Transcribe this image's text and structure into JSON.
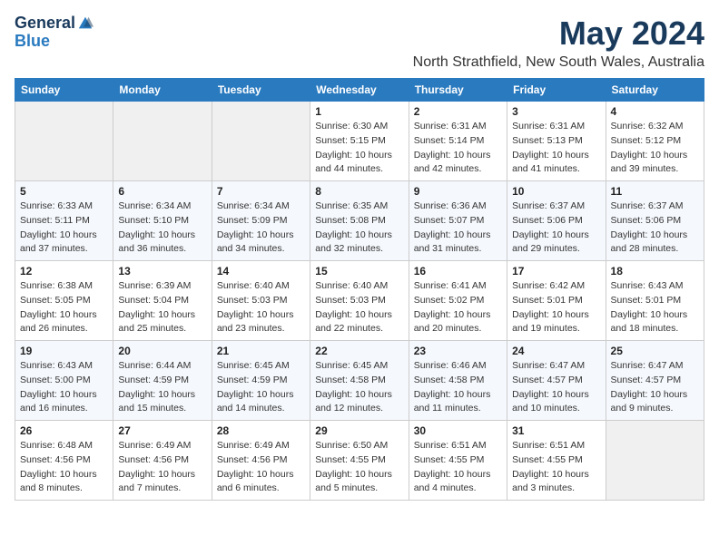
{
  "logo": {
    "general": "General",
    "blue": "Blue"
  },
  "title": "May 2024",
  "subtitle": "North Strathfield, New South Wales, Australia",
  "headers": [
    "Sunday",
    "Monday",
    "Tuesday",
    "Wednesday",
    "Thursday",
    "Friday",
    "Saturday"
  ],
  "weeks": [
    [
      {
        "day": "",
        "info": []
      },
      {
        "day": "",
        "info": []
      },
      {
        "day": "",
        "info": []
      },
      {
        "day": "1",
        "info": [
          "Sunrise: 6:30 AM",
          "Sunset: 5:15 PM",
          "Daylight: 10 hours",
          "and 44 minutes."
        ]
      },
      {
        "day": "2",
        "info": [
          "Sunrise: 6:31 AM",
          "Sunset: 5:14 PM",
          "Daylight: 10 hours",
          "and 42 minutes."
        ]
      },
      {
        "day": "3",
        "info": [
          "Sunrise: 6:31 AM",
          "Sunset: 5:13 PM",
          "Daylight: 10 hours",
          "and 41 minutes."
        ]
      },
      {
        "day": "4",
        "info": [
          "Sunrise: 6:32 AM",
          "Sunset: 5:12 PM",
          "Daylight: 10 hours",
          "and 39 minutes."
        ]
      }
    ],
    [
      {
        "day": "5",
        "info": [
          "Sunrise: 6:33 AM",
          "Sunset: 5:11 PM",
          "Daylight: 10 hours",
          "and 37 minutes."
        ]
      },
      {
        "day": "6",
        "info": [
          "Sunrise: 6:34 AM",
          "Sunset: 5:10 PM",
          "Daylight: 10 hours",
          "and 36 minutes."
        ]
      },
      {
        "day": "7",
        "info": [
          "Sunrise: 6:34 AM",
          "Sunset: 5:09 PM",
          "Daylight: 10 hours",
          "and 34 minutes."
        ]
      },
      {
        "day": "8",
        "info": [
          "Sunrise: 6:35 AM",
          "Sunset: 5:08 PM",
          "Daylight: 10 hours",
          "and 32 minutes."
        ]
      },
      {
        "day": "9",
        "info": [
          "Sunrise: 6:36 AM",
          "Sunset: 5:07 PM",
          "Daylight: 10 hours",
          "and 31 minutes."
        ]
      },
      {
        "day": "10",
        "info": [
          "Sunrise: 6:37 AM",
          "Sunset: 5:06 PM",
          "Daylight: 10 hours",
          "and 29 minutes."
        ]
      },
      {
        "day": "11",
        "info": [
          "Sunrise: 6:37 AM",
          "Sunset: 5:06 PM",
          "Daylight: 10 hours",
          "and 28 minutes."
        ]
      }
    ],
    [
      {
        "day": "12",
        "info": [
          "Sunrise: 6:38 AM",
          "Sunset: 5:05 PM",
          "Daylight: 10 hours",
          "and 26 minutes."
        ]
      },
      {
        "day": "13",
        "info": [
          "Sunrise: 6:39 AM",
          "Sunset: 5:04 PM",
          "Daylight: 10 hours",
          "and 25 minutes."
        ]
      },
      {
        "day": "14",
        "info": [
          "Sunrise: 6:40 AM",
          "Sunset: 5:03 PM",
          "Daylight: 10 hours",
          "and 23 minutes."
        ]
      },
      {
        "day": "15",
        "info": [
          "Sunrise: 6:40 AM",
          "Sunset: 5:03 PM",
          "Daylight: 10 hours",
          "and 22 minutes."
        ]
      },
      {
        "day": "16",
        "info": [
          "Sunrise: 6:41 AM",
          "Sunset: 5:02 PM",
          "Daylight: 10 hours",
          "and 20 minutes."
        ]
      },
      {
        "day": "17",
        "info": [
          "Sunrise: 6:42 AM",
          "Sunset: 5:01 PM",
          "Daylight: 10 hours",
          "and 19 minutes."
        ]
      },
      {
        "day": "18",
        "info": [
          "Sunrise: 6:43 AM",
          "Sunset: 5:01 PM",
          "Daylight: 10 hours",
          "and 18 minutes."
        ]
      }
    ],
    [
      {
        "day": "19",
        "info": [
          "Sunrise: 6:43 AM",
          "Sunset: 5:00 PM",
          "Daylight: 10 hours",
          "and 16 minutes."
        ]
      },
      {
        "day": "20",
        "info": [
          "Sunrise: 6:44 AM",
          "Sunset: 4:59 PM",
          "Daylight: 10 hours",
          "and 15 minutes."
        ]
      },
      {
        "day": "21",
        "info": [
          "Sunrise: 6:45 AM",
          "Sunset: 4:59 PM",
          "Daylight: 10 hours",
          "and 14 minutes."
        ]
      },
      {
        "day": "22",
        "info": [
          "Sunrise: 6:45 AM",
          "Sunset: 4:58 PM",
          "Daylight: 10 hours",
          "and 12 minutes."
        ]
      },
      {
        "day": "23",
        "info": [
          "Sunrise: 6:46 AM",
          "Sunset: 4:58 PM",
          "Daylight: 10 hours",
          "and 11 minutes."
        ]
      },
      {
        "day": "24",
        "info": [
          "Sunrise: 6:47 AM",
          "Sunset: 4:57 PM",
          "Daylight: 10 hours",
          "and 10 minutes."
        ]
      },
      {
        "day": "25",
        "info": [
          "Sunrise: 6:47 AM",
          "Sunset: 4:57 PM",
          "Daylight: 10 hours",
          "and 9 minutes."
        ]
      }
    ],
    [
      {
        "day": "26",
        "info": [
          "Sunrise: 6:48 AM",
          "Sunset: 4:56 PM",
          "Daylight: 10 hours",
          "and 8 minutes."
        ]
      },
      {
        "day": "27",
        "info": [
          "Sunrise: 6:49 AM",
          "Sunset: 4:56 PM",
          "Daylight: 10 hours",
          "and 7 minutes."
        ]
      },
      {
        "day": "28",
        "info": [
          "Sunrise: 6:49 AM",
          "Sunset: 4:56 PM",
          "Daylight: 10 hours",
          "and 6 minutes."
        ]
      },
      {
        "day": "29",
        "info": [
          "Sunrise: 6:50 AM",
          "Sunset: 4:55 PM",
          "Daylight: 10 hours",
          "and 5 minutes."
        ]
      },
      {
        "day": "30",
        "info": [
          "Sunrise: 6:51 AM",
          "Sunset: 4:55 PM",
          "Daylight: 10 hours",
          "and 4 minutes."
        ]
      },
      {
        "day": "31",
        "info": [
          "Sunrise: 6:51 AM",
          "Sunset: 4:55 PM",
          "Daylight: 10 hours",
          "and 3 minutes."
        ]
      },
      {
        "day": "",
        "info": []
      }
    ]
  ]
}
